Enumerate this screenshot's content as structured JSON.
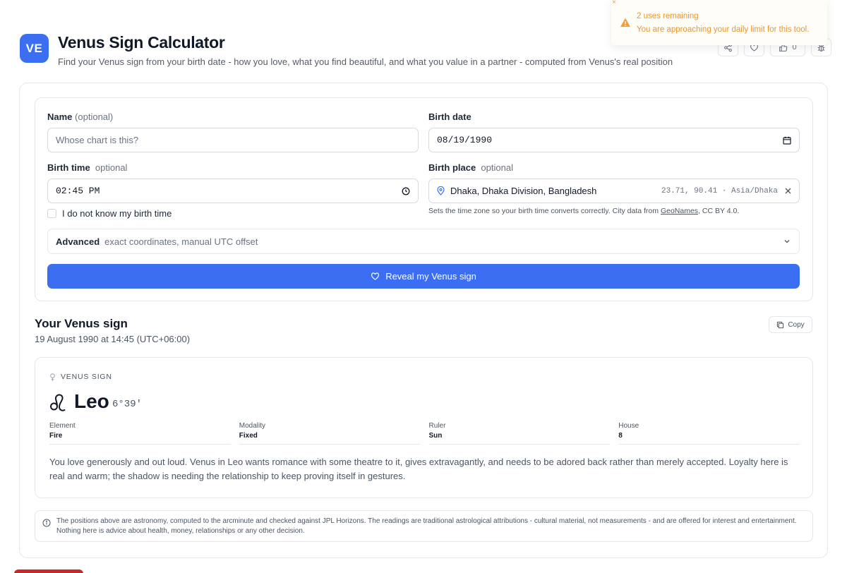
{
  "toast": {
    "title": "2 uses remaining",
    "message": "You are approaching your daily limit for this tool.",
    "close": "×",
    "icon": "warning-triangle-icon"
  },
  "header": {
    "logo": "VE",
    "title": "Venus Sign Calculator",
    "subtitle": "Find your Venus sign from your birth date - how you love, what you find beautiful, and what you value in a partner - computed from Venus's real position",
    "like_count": "0",
    "actions": [
      "share-icon",
      "heart-icon",
      "thumbs-up-icon",
      "bug-icon"
    ]
  },
  "form": {
    "name_label": "Name",
    "name_optional": "(optional)",
    "name_placeholder": "Whose chart is this?",
    "date_label": "Birth date",
    "date_value": "08/19/1990",
    "time_label": "Birth time",
    "time_optional": "optional",
    "time_value": "02:45 PM",
    "place_label": "Birth place",
    "place_optional": "optional",
    "place_value": "Dhaka, Dhaka Division, Bangladesh",
    "place_coords": "23.71, 90.41 · Asia/Dhaka",
    "unknown_time_label": "I do not know my birth time",
    "help_text": "Sets the time zone so your birth time converts correctly. City data from",
    "help_link": "GeoNames",
    "help_suffix": ", CC BY 4.0.",
    "advanced_label": "Advanced",
    "advanced_sub": "exact coordinates, manual UTC offset",
    "submit_label": "Reveal my Venus sign"
  },
  "result": {
    "title": "Your Venus sign",
    "date_text": "19 August 1990 at 14:45 (UTC+06:00)",
    "copy_label": "Copy",
    "section_label": "VENUS SIGN",
    "sign": "Leo",
    "degree": "6°39'",
    "attributes": [
      {
        "key": "Element",
        "value": "Fire"
      },
      {
        "key": "Modality",
        "value": "Fixed"
      },
      {
        "key": "Ruler",
        "value": "Sun"
      },
      {
        "key": "House",
        "value": "8"
      }
    ],
    "description": "You love generously and out loud. Venus in Leo wants romance with some theatre to it, gives extravagantly, and needs to be adored back rather than merely accepted. Loyalty here is real and warm; the shadow is needing the relationship to keep proving itself in gestures."
  },
  "disclaimer": "The positions above are astronomy, computed to the arcminute and checked against JPL Horizons. The readings are traditional astrological attributions - cultural material, not measurements - and are offered for interest and entertainment. Nothing here is advice about health, money, relationships or any other decision.",
  "colors": {
    "accent": "#3b6ef0",
    "warning": "#e69632",
    "bottom_bar": "#c62828"
  }
}
